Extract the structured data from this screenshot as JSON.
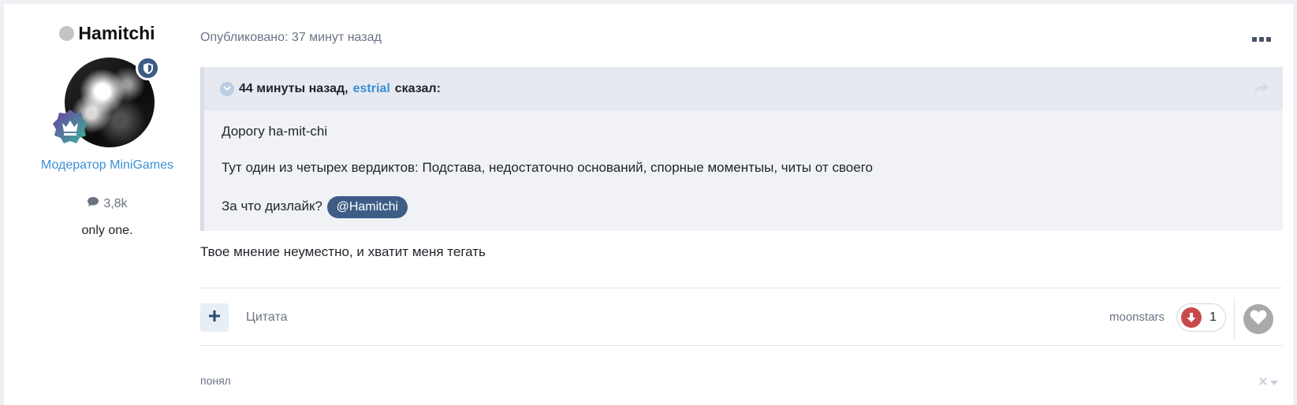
{
  "author": {
    "name": "Hamitchi",
    "status": "offline",
    "title": "Модератор MiniGames",
    "post_count": "3,8k",
    "post_count_icon": "comment-icon",
    "signature": "only one.",
    "mod_badge_icon": "shield-icon",
    "rank_badge_icon": "crown-icon"
  },
  "post": {
    "meta": "Опубликовано: 37 минут назад",
    "more_icon": "ellipsis-icon",
    "quote": {
      "time": "44 минуты назад,",
      "author": "estrial",
      "said": "сказал:",
      "lines": [
        "Дорогу ha-mit-chi",
        "Тут один из четырех вердиктов: Подстава, недостаточно оснований, спорные моментыы, читы от своего"
      ],
      "last_line_prefix": "За что дизлайк?",
      "mention": "@Hamitchi"
    },
    "reply": "Твое мнение неуместно, и хватит меня тегать"
  },
  "actions": {
    "add_icon": "plus-icon",
    "quote_label": "Цитата",
    "reaction_user": "moonstars",
    "reaction_icon": "thumbs-down-icon",
    "reaction_count": "1",
    "like_icon": "heart-icon"
  },
  "comment": {
    "text": "понял"
  },
  "colors": {
    "accent": "#3a8ed6",
    "mention_bg": "#3e5d86",
    "reaction_red": "#c94a4a"
  }
}
